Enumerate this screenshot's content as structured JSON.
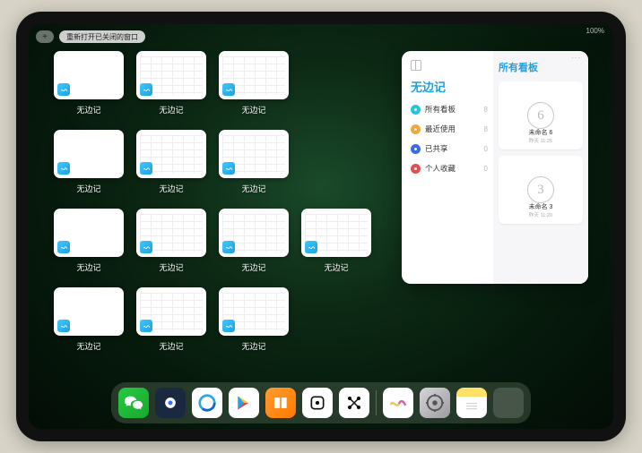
{
  "status": {
    "right": "100%"
  },
  "top": {
    "add_label": "+",
    "reopen_label": "重新打开已关闭的窗口"
  },
  "app": {
    "name": "无边记"
  },
  "panel": {
    "title": "无边记",
    "right_title": "所有看板",
    "ellipsis": "···",
    "sidebar": [
      {
        "label": "所有看板",
        "count": "8",
        "color": "#29c2e0"
      },
      {
        "label": "最近使用",
        "count": "8",
        "color": "#f2a73b"
      },
      {
        "label": "已共享",
        "count": "0",
        "color": "#3b6be0"
      },
      {
        "label": "个人收藏",
        "count": "0",
        "color": "#e05050"
      }
    ],
    "boards": [
      {
        "glyph": "6",
        "name": "未命名 6",
        "time": "昨天 11:25"
      },
      {
        "glyph": "3",
        "name": "未命名 3",
        "time": "昨天 11:20"
      }
    ]
  },
  "thumbs": [
    {
      "kind": "blank"
    },
    {
      "kind": "calendar"
    },
    {
      "kind": "calendar"
    },
    {
      "kind": "blank"
    },
    {
      "kind": "calendar"
    },
    {
      "kind": "calendar"
    },
    {
      "kind": "blank"
    },
    {
      "kind": "calendar"
    },
    {
      "kind": "calendar"
    },
    {
      "kind": "calendar"
    },
    {
      "kind": "blank"
    },
    {
      "kind": "calendar"
    },
    {
      "kind": "calendar"
    }
  ],
  "dock": {
    "apps": [
      {
        "name": "WeChat"
      },
      {
        "name": "Browser-HD"
      },
      {
        "name": "QQBrowser"
      },
      {
        "name": "PlayStore"
      },
      {
        "name": "Books"
      },
      {
        "name": "DotApp"
      },
      {
        "name": "NodesApp"
      },
      {
        "name": "Freeform"
      },
      {
        "name": "Settings"
      },
      {
        "name": "Notes"
      }
    ]
  }
}
